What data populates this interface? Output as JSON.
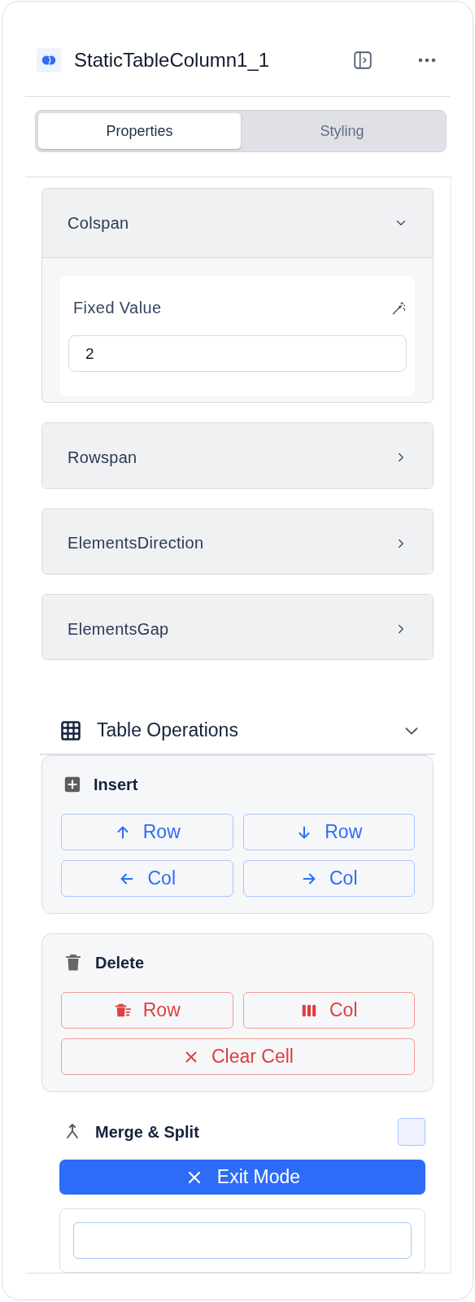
{
  "header": {
    "title": "StaticTableColumn1_1"
  },
  "tabs": [
    {
      "label": "Properties",
      "selected": true
    },
    {
      "label": "Styling",
      "selected": false
    }
  ],
  "sections": [
    {
      "title": "Colspan",
      "expanded": true,
      "field": {
        "label": "Fixed Value",
        "value": "2"
      }
    },
    {
      "title": "Rowspan",
      "expanded": false
    },
    {
      "title": "ElementsDirection",
      "expanded": false
    },
    {
      "title": "ElementsGap",
      "expanded": false
    }
  ],
  "table_operations": {
    "title": "Table Operations",
    "expanded": true,
    "groups": [
      {
        "title": "Insert",
        "kind": "insert",
        "buttons": [
          {
            "label": "Row",
            "kind": "up"
          },
          {
            "label": "Row",
            "kind": "down"
          },
          {
            "label": "Col",
            "kind": "left"
          },
          {
            "label": "Col",
            "kind": "right"
          }
        ]
      },
      {
        "title": "Delete",
        "kind": "delete",
        "buttons": [
          {
            "label": "Row",
            "kind": "row"
          },
          {
            "label": "Col",
            "kind": "column"
          },
          {
            "label": "Clear Cell",
            "kind": "clear"
          }
        ]
      }
    ],
    "merge_split": {
      "title": "Merge & Split",
      "checked": false,
      "exit_button": "Exit Mode"
    }
  }
}
